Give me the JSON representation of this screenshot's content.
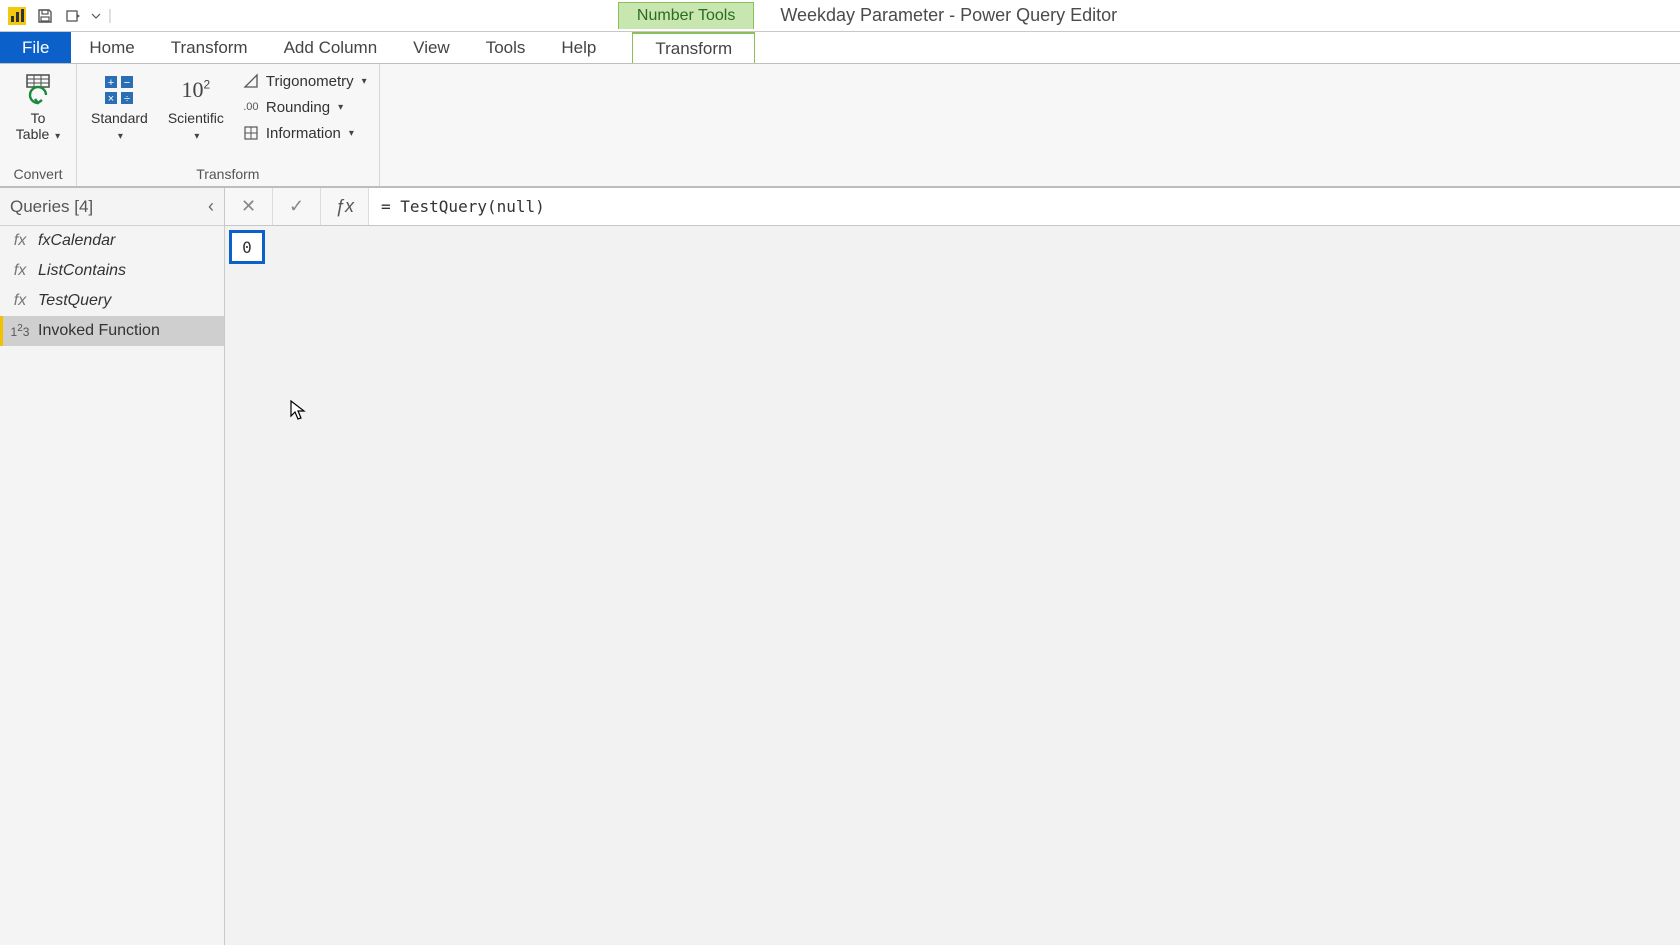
{
  "titlebar": {
    "context_tool_group": "Number Tools",
    "window_title": "Weekday Parameter - Power Query Editor"
  },
  "menu": {
    "file": "File",
    "tabs": [
      "Home",
      "Transform",
      "Add Column",
      "View",
      "Tools",
      "Help"
    ],
    "context_tab": "Transform"
  },
  "ribbon": {
    "group_convert": {
      "label": "Convert",
      "to_table": "To\nTable"
    },
    "group_transform": {
      "label": "Transform",
      "standard": "Standard",
      "scientific": "Scientific",
      "trigonometry": "Trigonometry",
      "rounding": "Rounding",
      "information": "Information"
    }
  },
  "sidebar": {
    "header": "Queries [4]",
    "items": [
      {
        "icon": "fx",
        "label": "fxCalendar"
      },
      {
        "icon": "fx",
        "label": "ListContains"
      },
      {
        "icon": "fx",
        "label": "TestQuery"
      },
      {
        "icon": "123",
        "label": "Invoked Function"
      }
    ],
    "selected_index": 3
  },
  "formula_bar": {
    "value": "= TestQuery(null)"
  },
  "result": {
    "value": "0"
  }
}
